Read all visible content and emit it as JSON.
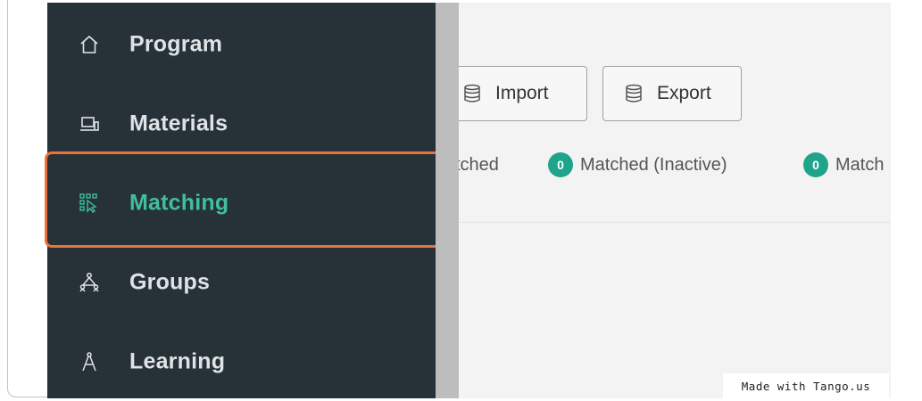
{
  "sidebar": {
    "items": [
      {
        "label": "Program",
        "icon": "home-icon",
        "active": false
      },
      {
        "label": "Materials",
        "icon": "laptop-icon",
        "active": false
      },
      {
        "label": "Matching",
        "icon": "matching-icon",
        "active": true
      },
      {
        "label": "Groups",
        "icon": "groups-icon",
        "active": false
      },
      {
        "label": "Learning",
        "icon": "compass-icon",
        "active": false
      }
    ]
  },
  "toolbar": {
    "import_label": "Import",
    "export_label": "Export"
  },
  "filters": [
    {
      "label": "tched"
    },
    {
      "count": "0",
      "label": "Matched (Inactive)"
    },
    {
      "count": "0",
      "label": "Match"
    }
  ],
  "watermark": "Made with Tango.us",
  "colors": {
    "sidebar_bg": "#263238",
    "active_text": "#3fbf9b",
    "highlight": "#e8743c",
    "badge": "#1ea48a"
  }
}
